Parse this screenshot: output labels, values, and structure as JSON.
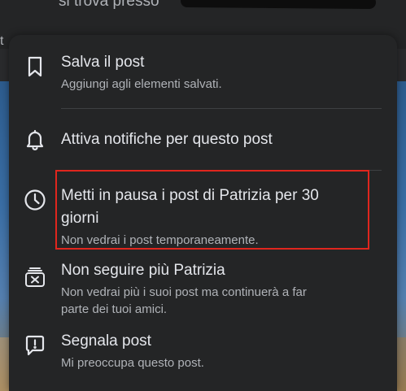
{
  "background": {
    "top_text": "si trova presso",
    "left_char": "t"
  },
  "menu": {
    "items": [
      {
        "icon": "bookmark-icon",
        "title": "Salva il post",
        "description": "Aggiungi agli elementi salvati."
      },
      {
        "icon": "bell-icon",
        "title": "Attiva notifiche per questo post",
        "description": ""
      },
      {
        "icon": "clock-icon",
        "title_line1": "Metti in pausa i post di Patrizia per 30",
        "title_line2": "giorni",
        "description": "Non vedrai i post temporaneamente."
      },
      {
        "icon": "unfollow-icon",
        "title": "Non seguire più Patrizia",
        "description_line1": "Non vedrai più i suoi post ma continuerà a far",
        "description_line2": "parte dei tuoi amici."
      },
      {
        "icon": "report-icon",
        "title": "Segnala post",
        "description": "Mi preoccupa questo post."
      }
    ],
    "highlight_color": "#e0261e"
  }
}
